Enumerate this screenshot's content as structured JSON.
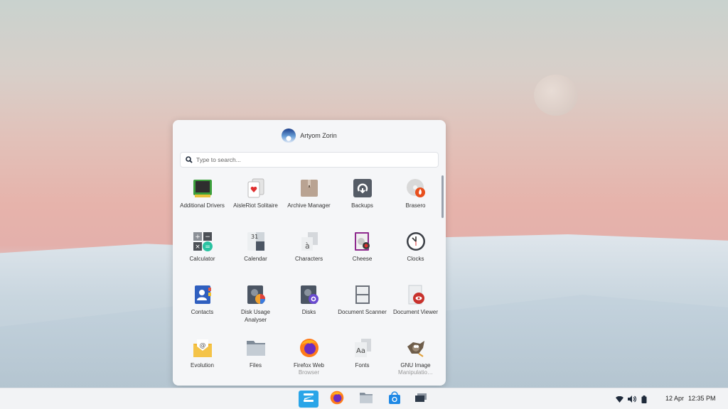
{
  "user": {
    "name": "Artyom Zorin"
  },
  "search": {
    "placeholder": "Type to search..."
  },
  "apps": [
    {
      "label": "Additional Drivers",
      "icon": "drivers-icon"
    },
    {
      "label": "AisleRiot Solitaire",
      "icon": "cards-icon"
    },
    {
      "label": "Archive Manager",
      "icon": "archive-icon"
    },
    {
      "label": "Backups",
      "icon": "backup-icon"
    },
    {
      "label": "Brasero",
      "icon": "disc-burner-icon"
    },
    {
      "label": "Calculator",
      "icon": "calculator-icon"
    },
    {
      "label": "Calendar",
      "icon": "calendar-icon"
    },
    {
      "label": "Characters",
      "icon": "characters-icon"
    },
    {
      "label": "Cheese",
      "icon": "webcam-icon"
    },
    {
      "label": "Clocks",
      "icon": "clock-icon"
    },
    {
      "label": "Contacts",
      "icon": "contacts-icon"
    },
    {
      "label": "Disk Usage Analyser",
      "icon": "disk-usage-icon"
    },
    {
      "label": "Disks",
      "icon": "disks-icon"
    },
    {
      "label": "Document Scanner",
      "icon": "scanner-icon"
    },
    {
      "label": "Document Viewer",
      "icon": "document-viewer-icon"
    },
    {
      "label": "Evolution",
      "icon": "mail-icon"
    },
    {
      "label": "Files",
      "icon": "folder-icon"
    },
    {
      "label": "Firefox Web",
      "sub": "Browser",
      "icon": "firefox-icon"
    },
    {
      "label": "Fonts",
      "icon": "fonts-icon"
    },
    {
      "label": "GNU Image",
      "sub": "Manipulatio…",
      "icon": "gimp-icon"
    }
  ],
  "taskbar": {
    "items": [
      "zorin-menu-icon",
      "firefox-icon",
      "files-icon",
      "software-store-icon",
      "windows-icon"
    ]
  },
  "tray": {
    "date": "12 Apr",
    "time": "12:35 PM"
  }
}
